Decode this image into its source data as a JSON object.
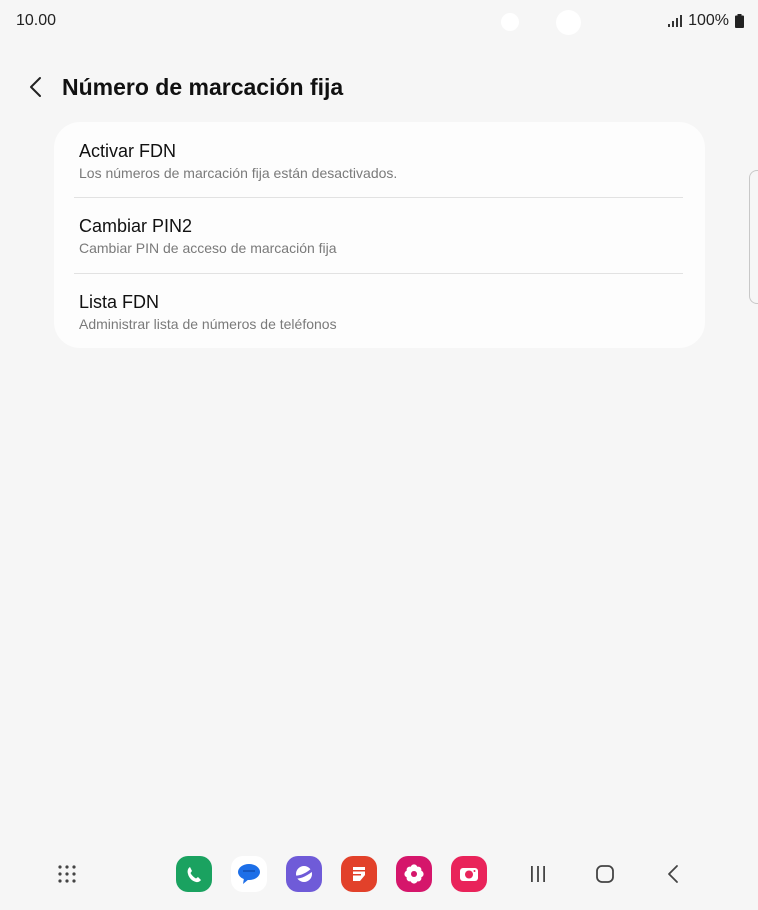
{
  "status_bar": {
    "time": "10.00",
    "battery": "100%"
  },
  "header": {
    "title": "Número de marcación fija"
  },
  "settings": [
    {
      "title": "Activar FDN",
      "subtitle": "Los números de marcación fija están desactivados."
    },
    {
      "title": "Cambiar PIN2",
      "subtitle": "Cambiar PIN de acceso de marcación fija"
    },
    {
      "title": "Lista FDN",
      "subtitle": "Administrar lista de números de teléfonos"
    }
  ],
  "nav_bar": {
    "apps": [
      {
        "name": "phone-icon",
        "color": "#1aa260"
      },
      {
        "name": "messages-icon",
        "color": "#ffffff"
      },
      {
        "name": "internet-icon",
        "color": "#6f5bd8"
      },
      {
        "name": "notes-icon",
        "color": "#e2412a"
      },
      {
        "name": "gallery-icon",
        "color": "#d5166b"
      },
      {
        "name": "camera-icon",
        "color": "#e9235a"
      }
    ]
  }
}
